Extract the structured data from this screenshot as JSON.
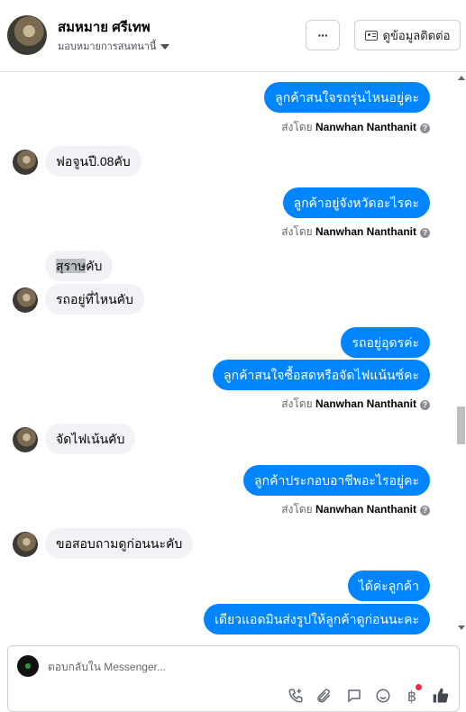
{
  "header": {
    "name": "สมหมาย ศรีเทพ",
    "subtitle": "มอบหมายการสนทนานี้",
    "more_label": "···",
    "info_label": "ดูข้อมูลติดต่อ"
  },
  "messages": [
    {
      "dir": "out",
      "text": "ลูกค้าสนใจรถรุ่นไหนอยู่คะ"
    },
    {
      "type": "sent_by",
      "prefix": "ส่งโดย",
      "name": "Nanwhan Nanthanit"
    },
    {
      "dir": "in",
      "text": "ฟอจูนปี.08คับ"
    },
    {
      "dir": "out",
      "text": "ลูกค้าอยู่จังหวัดอะไรคะ"
    },
    {
      "type": "sent_by",
      "prefix": "ส่งโดย",
      "name": "Nanwhan Nanthanit"
    },
    {
      "dir": "in",
      "text_highlight": "สุราษ",
      "text_rest": "คับ"
    },
    {
      "dir": "in",
      "text": "รถอยู่ที่ไหนคับ"
    },
    {
      "dir": "out",
      "text": "รถอยู่อุดรค่ะ"
    },
    {
      "dir": "out",
      "text": "ลูกค้าสนใจซื้อสดหรือจัดไฟแน้นซ์คะ"
    },
    {
      "type": "sent_by",
      "prefix": "ส่งโดย",
      "name": "Nanwhan Nanthanit"
    },
    {
      "dir": "in",
      "text": "จัดไฟเน้นคับ"
    },
    {
      "dir": "out",
      "text": "ลูกค้าประกอบอาชีพอะไรอยู่คะ"
    },
    {
      "type": "sent_by",
      "prefix": "ส่งโดย",
      "name": "Nanwhan Nanthanit"
    },
    {
      "dir": "in",
      "text": "ขอสอบถามดูก่อนนะคับ"
    },
    {
      "dir": "out",
      "text": "ได้ค่ะลูกค้า"
    },
    {
      "dir": "out",
      "text": "เดียวแอดมินส่งรูปให้ลูกค้าดูก่อนนะคะ"
    }
  ],
  "composer": {
    "placeholder": "ตอบกลับใน Messenger..."
  },
  "icons": {
    "call": "phone-plus-icon",
    "attach": "paperclip-icon",
    "saved_replies": "chat-bubble-icon",
    "emoji": "smiley-icon",
    "payment": "baht-icon",
    "like": "thumbs-up-icon"
  },
  "colors": {
    "outgoing_bubble": "#0084ff",
    "incoming_bubble": "#f0f2f5",
    "notification_dot": "#f02849"
  }
}
